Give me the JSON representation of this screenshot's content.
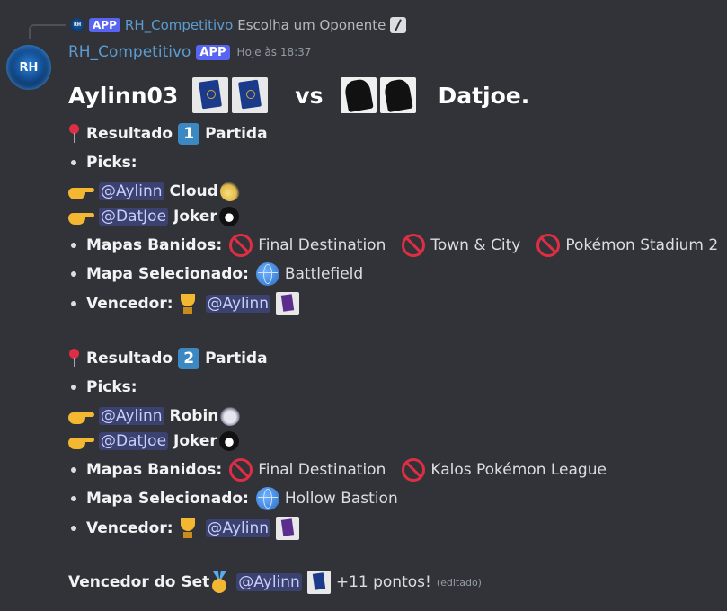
{
  "reply": {
    "avatar_text": "RH",
    "app_tag": "APP",
    "name": "RH_Competitivo",
    "command": "Escolha um Oponente"
  },
  "message": {
    "avatar_text": "RH",
    "author": "RH_Competitivo",
    "app_tag": "APP",
    "timestamp": "Hoje às 18:37"
  },
  "matchup": {
    "player1": "Aylinn03",
    "vs": "vs",
    "player2": "Datjoe."
  },
  "results": [
    {
      "label": "Resultado",
      "number": "1",
      "suffix": "Partida",
      "picks_label": "Picks:",
      "picks": [
        {
          "mention": "@Aylinn",
          "character": "Cloud",
          "icon": "cloud-character-icon"
        },
        {
          "mention": "@DatJoe",
          "character": "Joker",
          "icon": "joker-character-icon"
        }
      ],
      "banned_label": "Mapas Banidos:",
      "banned": [
        "Final Destination",
        "Town & City",
        "Pokémon Stadium 2"
      ],
      "selected_label": "Mapa Selecionado:",
      "selected": "Battlefield",
      "winner_label": "Vencedor:",
      "winner": "@Aylinn"
    },
    {
      "label": "Resultado",
      "number": "2",
      "suffix": "Partida",
      "picks_label": "Picks:",
      "picks": [
        {
          "mention": "@Aylinn",
          "character": "Robin",
          "icon": "robin-character-icon"
        },
        {
          "mention": "@DatJoe",
          "character": "Joker",
          "icon": "joker-character-icon"
        }
      ],
      "banned_label": "Mapas Banidos:",
      "banned": [
        "Final Destination",
        "Kalos Pokémon League"
      ],
      "selected_label": "Mapa Selecionado:",
      "selected": "Hollow Bastion",
      "winner_label": "Vencedor:",
      "winner": "@Aylinn"
    }
  ],
  "set_winner": {
    "label": "Vencedor do Set",
    "mention": "@Aylinn",
    "points": "+11 pontos!",
    "edited": "(editado)"
  },
  "colors": {
    "background": "#313338",
    "author": "#5c9ccf",
    "app_tag": "#5865f2",
    "mention_bg": "#3c4270"
  }
}
